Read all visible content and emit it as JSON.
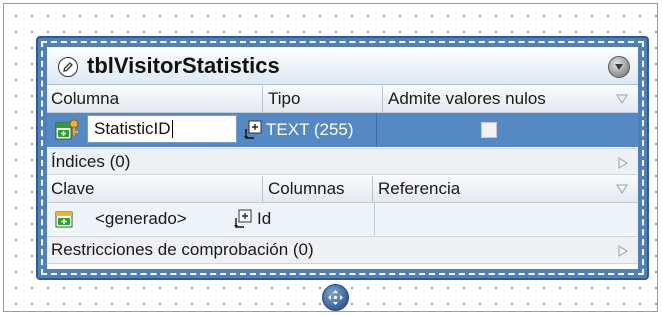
{
  "table": {
    "name": "tblVisitorStatistics"
  },
  "columns": {
    "header": {
      "name": "Columna",
      "type": "Tipo",
      "nullable": "Admite valores nulos"
    },
    "rows": [
      {
        "name": "StatisticID",
        "type": "TEXT (255)",
        "nullable": false
      }
    ]
  },
  "indexes": {
    "label": "Índices (0)"
  },
  "keys": {
    "header": {
      "key": "Clave",
      "columns": "Columnas",
      "reference": "Referencia"
    },
    "rows": [
      {
        "name": "<generado>",
        "columns": "Id",
        "reference": ""
      }
    ]
  },
  "checks": {
    "label": "Restricciones de comprobación (0)"
  },
  "colors": {
    "table_border": "#4f80bd",
    "selected_row": "#5589c3",
    "key_icon": "#f2b32a",
    "primary_key_green": "#2aa52a"
  },
  "icons": {
    "title": "edit-pencil-icon",
    "collapse": "collapse-down-icon",
    "column_key": "primary-key-column-icon",
    "expand": "plus-expand-icon",
    "key_row": "key-constraint-icon",
    "filter": "sort-triangle-icon",
    "handle": "move-handle-icon"
  }
}
